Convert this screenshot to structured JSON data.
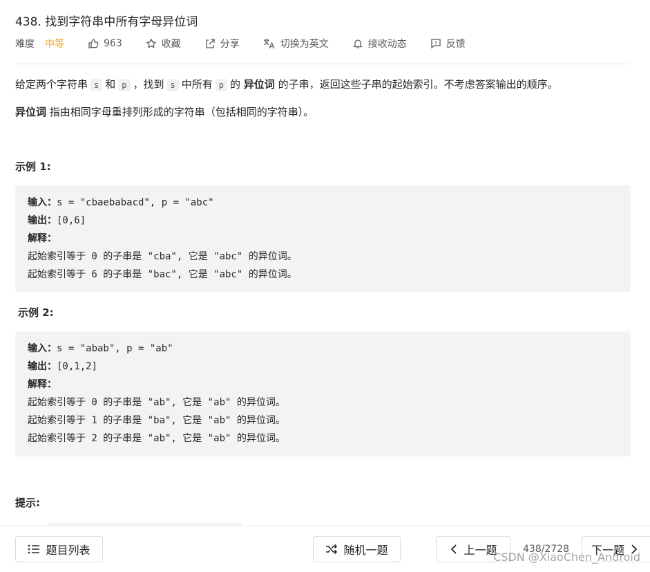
{
  "problem": {
    "title": "438. 找到字符串中所有字母异位词"
  },
  "meta": {
    "difficulty_label": "难度",
    "difficulty": "中等",
    "likes": "963",
    "favorite": "收藏",
    "share": "分享",
    "translate": "切换为英文",
    "notify": "接收动态",
    "feedback": "反馈",
    "colors": {
      "difficulty": "#f0a020"
    }
  },
  "description": {
    "p1": {
      "t1": "给定两个字符串",
      "c1": "s",
      "t2": "和",
      "c2": "p",
      "t3": "，找到",
      "c3": "s",
      "t4": "中所有",
      "c4": "p",
      "t5": "的",
      "bold": "异位词",
      "t6": "的子串，返回这些子串的起始索引。不考虑答案输出的顺序。"
    },
    "p2": {
      "bold": "异位词",
      "text": "指由相同字母重排列形成的字符串（包括相同的字符串）。"
    }
  },
  "examples": [
    {
      "title": "示例 1:",
      "input_label": "输入：",
      "input_value": "s = \"cbaebabacd\", p = \"abc\"",
      "output_label": "输出：",
      "output_value": "[0,6]",
      "explain_label": "解释：",
      "explain_lines": [
        "起始索引等于 0 的子串是 \"cba\", 它是 \"abc\" 的异位词。",
        "起始索引等于 6 的子串是 \"bac\", 它是 \"abc\" 的异位词。"
      ]
    },
    {
      "title": "示例 2:",
      "input_label": "输入：",
      "input_value": "s = \"abab\", p = \"ab\"",
      "output_label": "输出：",
      "output_value": "[0,1,2]",
      "explain_label": "解释：",
      "explain_lines": [
        "起始索引等于 0 的子串是 \"ab\", 它是 \"ab\" 的异位词。",
        "起始索引等于 1 的子串是 \"ba\", 它是 \"ab\" 的异位词。",
        "起始索引等于 2 的子串是 \"ab\", 它是 \"ab\" 的异位词。"
      ]
    }
  ],
  "hint_title": "提示:",
  "bottom_bar": {
    "list_button": "题目列表",
    "random_button": "随机一题",
    "prev_button": "上一题",
    "counter": "438/2728",
    "next_button": "下一题"
  },
  "watermark": "CSDN @XiaoChen_Android"
}
